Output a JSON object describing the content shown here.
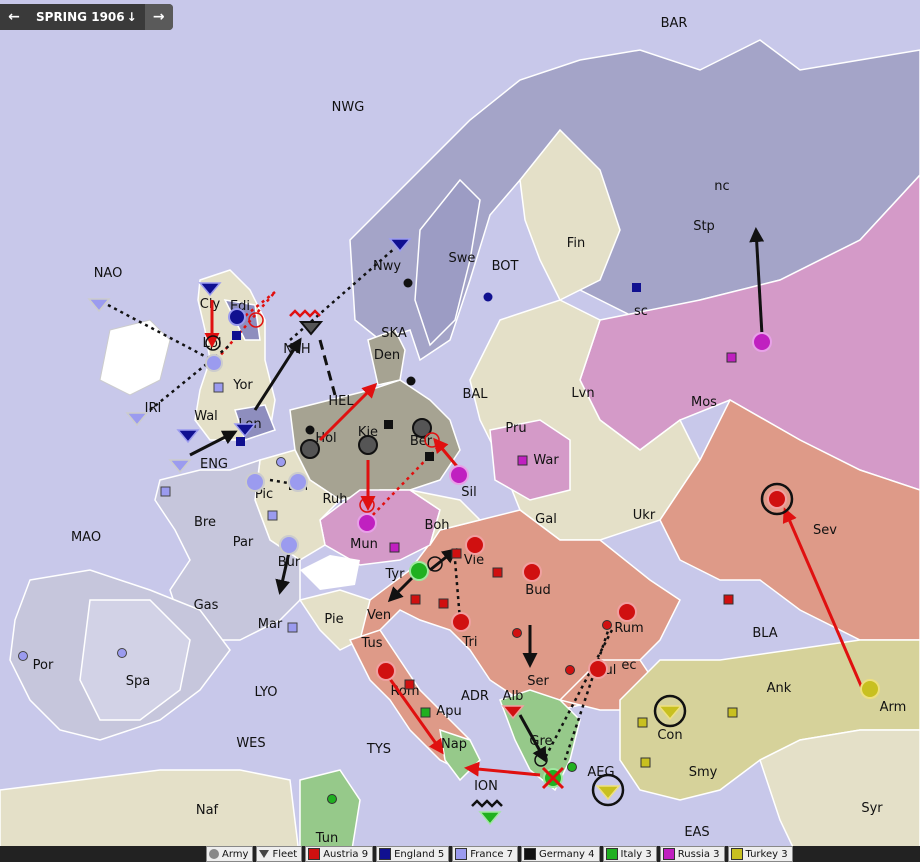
{
  "nav": {
    "prev_icon": "arrow-left-icon",
    "phase_label": "SPRING 1906",
    "phase_icon": "arrow-down-icon",
    "next_icon": "arrow-right-icon"
  },
  "colors": {
    "sea": "#c8c8ea",
    "neutral": "#e4e0c8",
    "austria": "#de9a88",
    "england": "#8e8ebe",
    "france": "#c6c6dc",
    "germany": "#a6a392",
    "italy": "#96c98a",
    "russia": "#d49ac8",
    "turkey": "#d6d29a"
  },
  "regions": [
    "BAR",
    "NWG",
    "NAO",
    "Cly",
    "Edi",
    "Lpl",
    "Yor",
    "Wal",
    "Lon",
    "IRI",
    "ENG",
    "NTH",
    "Nwy",
    "Swe",
    "Fin",
    "BOT",
    "SKA",
    "Den",
    "HEL",
    "BAL",
    "Lvn",
    "Stp",
    "nc",
    "sc",
    "Mos",
    "Hol",
    "Kie",
    "Ber",
    "Pru",
    "War",
    "Bel",
    "Ruh",
    "Sil",
    "Pic",
    "Bre",
    "Par",
    "MAO",
    "Mun",
    "Boh",
    "Gal",
    "Ukr",
    "Sev",
    "Bur",
    "Tyr",
    "Vie",
    "Bud",
    "Gas",
    "Ven",
    "Tri",
    "Rum",
    "BLA",
    "Mar",
    "Pie",
    "Tus",
    "Ser",
    "Bul",
    "ec",
    "Ank",
    "Arm",
    "Por",
    "Spa",
    "LYO",
    "Rom",
    "Apu",
    "ADR",
    "Alb",
    "Con",
    "WES",
    "TYS",
    "Nap",
    "Gre",
    "AEG",
    "Smy",
    "ION",
    "Naf",
    "Tun",
    "EAS",
    "Syr"
  ],
  "legend": [
    {
      "label": "Army",
      "kind": "army",
      "color": "#888"
    },
    {
      "label": "Fleet",
      "kind": "fleet",
      "color": "#444"
    },
    {
      "label": "Austria 9",
      "kind": "power",
      "color": "#d01010"
    },
    {
      "label": "England 5",
      "kind": "power",
      "color": "#101090"
    },
    {
      "label": "France 7",
      "kind": "power",
      "color": "#9b9bef"
    },
    {
      "label": "Germany 4",
      "kind": "power",
      "color": "#111111"
    },
    {
      "label": "Italy 3",
      "kind": "power",
      "color": "#20b020"
    },
    {
      "label": "Russia 3",
      "kind": "power",
      "color": "#c020c0"
    },
    {
      "label": "Turkey 3",
      "kind": "power",
      "color": "#c8c020"
    }
  ]
}
